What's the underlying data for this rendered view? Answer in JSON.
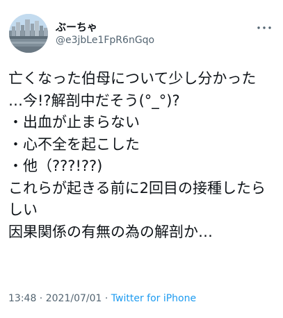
{
  "user": {
    "display_name": "ぶーちゃ",
    "handle": "@e3jbLe1FpR6nGqo",
    "avatar_icon": "city-skyline-avatar"
  },
  "menu": {
    "icon": "more-horizontal-icon"
  },
  "tweet": {
    "text": "亡くなった伯母について少し分かった\n…今!?解剖中だそう(°_°)?\n・出血が止まらない\n・心不全を起こした\n・他（???!??)\nこれらが起きる前に2回目の接種したらしい\n因果関係の有無の為の解剖か…"
  },
  "meta": {
    "time": "13:48",
    "separator1": " · ",
    "date": "2021/07/01",
    "separator2": " · ",
    "source": "Twitter for iPhone"
  },
  "colors": {
    "text": "#0f1419",
    "secondary": "#536471",
    "link": "#1d9bf0"
  }
}
